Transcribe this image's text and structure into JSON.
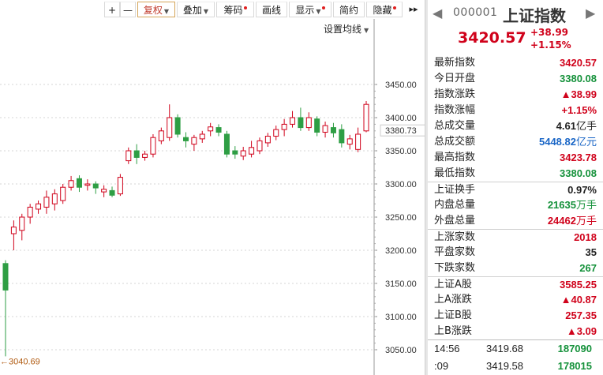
{
  "toolbar": {
    "plus": "+",
    "minus": "—",
    "fuquan": "复权",
    "diejia": "叠加",
    "chouma": "筹码",
    "huaxian": "画线",
    "xianshi": "显示",
    "jianyue": "简约",
    "yincang": "隐藏",
    "expand": "▸▸"
  },
  "chart_settings": {
    "label": "设置均线"
  },
  "bottom_tabs": [
    "",
    "",
    ""
  ],
  "chart_data": {
    "type": "candlestick",
    "y_ticks": [
      "3450.00",
      "3400.00",
      "3350.00",
      "3300.00",
      "3250.00",
      "3200.00",
      "3150.00",
      "3100.00",
      "3050.00"
    ],
    "ylim": [
      3040,
      3460
    ],
    "current_price_label": "3380.73",
    "min_label": "←3040.69",
    "up_color": "#d0021b",
    "down_color": "#2e9e44",
    "candles": [
      [
        3180,
        3140,
        3185,
        3040
      ],
      [
        3225,
        3235,
        3245,
        3200
      ],
      [
        3230,
        3250,
        3255,
        3215
      ],
      [
        3250,
        3265,
        3270,
        3240
      ],
      [
        3262,
        3270,
        3275,
        3255
      ],
      [
        3265,
        3280,
        3290,
        3255
      ],
      [
        3270,
        3285,
        3292,
        3260
      ],
      [
        3275,
        3295,
        3300,
        3270
      ],
      [
        3295,
        3305,
        3312,
        3290
      ],
      [
        3308,
        3295,
        3313,
        3288
      ],
      [
        3298,
        3300,
        3307,
        3290
      ],
      [
        3300,
        3294,
        3304,
        3285
      ],
      [
        3288,
        3292,
        3298,
        3280
      ],
      [
        3290,
        3283,
        3296,
        3280
      ],
      [
        3285,
        3310,
        3315,
        3282
      ],
      [
        3335,
        3350,
        3355,
        3330
      ],
      [
        3350,
        3340,
        3360,
        3330
      ],
      [
        3340,
        3345,
        3350,
        3335
      ],
      [
        3345,
        3370,
        3375,
        3340
      ],
      [
        3365,
        3380,
        3385,
        3360
      ],
      [
        3370,
        3400,
        3420,
        3365
      ],
      [
        3400,
        3375,
        3405,
        3370
      ],
      [
        3370,
        3365,
        3378,
        3355
      ],
      [
        3360,
        3370,
        3374,
        3350
      ],
      [
        3368,
        3375,
        3380,
        3362
      ],
      [
        3380,
        3386,
        3392,
        3372
      ],
      [
        3385,
        3378,
        3390,
        3372
      ],
      [
        3375,
        3345,
        3380,
        3340
      ],
      [
        3350,
        3345,
        3357,
        3338
      ],
      [
        3342,
        3350,
        3356,
        3336
      ],
      [
        3345,
        3355,
        3365,
        3340
      ],
      [
        3350,
        3365,
        3370,
        3345
      ],
      [
        3362,
        3372,
        3377,
        3356
      ],
      [
        3372,
        3382,
        3388,
        3366
      ],
      [
        3382,
        3390,
        3398,
        3372
      ],
      [
        3390,
        3400,
        3410,
        3385
      ],
      [
        3400,
        3385,
        3415,
        3380
      ],
      [
        3385,
        3400,
        3408,
        3380
      ],
      [
        3398,
        3378,
        3402,
        3372
      ],
      [
        3378,
        3388,
        3394,
        3370
      ],
      [
        3385,
        3377,
        3392,
        3370
      ],
      [
        3382,
        3362,
        3390,
        3355
      ],
      [
        3360,
        3368,
        3374,
        3352
      ],
      [
        3352,
        3375,
        3385,
        3348
      ],
      [
        3380,
        3420,
        3425,
        3378
      ]
    ]
  },
  "panel": {
    "code": "000001",
    "name": "上证指数",
    "price": "3420.57",
    "change": "+38.99",
    "change_pct": "+1.15%",
    "rows": [
      {
        "label": "最新指数",
        "value": "3420.57",
        "unit": "",
        "color": "red",
        "group": 1
      },
      {
        "label": "今日开盘",
        "value": "3380.08",
        "unit": "",
        "color": "green",
        "group": 1
      },
      {
        "label": "指数涨跌",
        "value": "▲38.99",
        "unit": "",
        "color": "red",
        "group": 1
      },
      {
        "label": "指数涨幅",
        "value": "+1.15%",
        "unit": "",
        "color": "red",
        "group": 1
      },
      {
        "label": "总成交量",
        "value": "4.61",
        "unit": "亿手",
        "color": "black",
        "group": 1
      },
      {
        "label": "总成交额",
        "value": "5448.82",
        "unit": "亿元",
        "color": "blue",
        "group": 1
      },
      {
        "label": "最高指数",
        "value": "3423.78",
        "unit": "",
        "color": "red",
        "group": 1
      },
      {
        "label": "最低指数",
        "value": "3380.08",
        "unit": "",
        "color": "green",
        "group": 1
      },
      {
        "label": "上证换手",
        "value": "0.97%",
        "unit": "",
        "color": "black",
        "group": 2
      },
      {
        "label": "内盘总量",
        "value": "21635",
        "unit": "万手",
        "color": "green",
        "group": 2
      },
      {
        "label": "外盘总量",
        "value": "24462",
        "unit": "万手",
        "color": "red",
        "group": 2
      },
      {
        "label": "上涨家数",
        "value": "2018",
        "unit": "",
        "color": "red",
        "group": 3
      },
      {
        "label": "平盘家数",
        "value": "35",
        "unit": "",
        "color": "black",
        "group": 3
      },
      {
        "label": "下跌家数",
        "value": "267",
        "unit": "",
        "color": "green",
        "group": 3
      },
      {
        "label": "上证A股",
        "value": "3585.25",
        "unit": "",
        "color": "red",
        "group": 4
      },
      {
        "label": "上A涨跌",
        "value": "▲40.87",
        "unit": "",
        "color": "red",
        "group": 4
      },
      {
        "label": "上证B股",
        "value": "257.35",
        "unit": "",
        "color": "red",
        "group": 4
      },
      {
        "label": "上B涨跌",
        "value": "▲3.09",
        "unit": "",
        "color": "red",
        "group": 4
      }
    ],
    "ticks": [
      {
        "time": "14:56",
        "price": "3419.68",
        "vol": "187090"
      },
      {
        "time": ":09",
        "price": "3419.58",
        "vol": "178015"
      }
    ]
  }
}
